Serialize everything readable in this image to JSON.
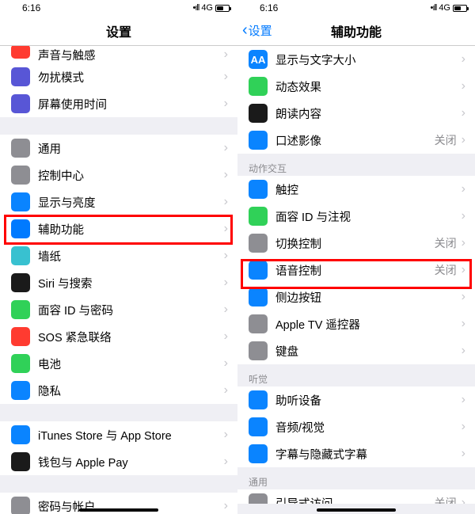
{
  "status": {
    "time": "6:16",
    "net": "4G",
    "signal": "•ıll"
  },
  "left": {
    "title": "设置",
    "rows": [
      {
        "id": "sound-haptics",
        "label": "声音与触感",
        "color": "#ff3b30"
      },
      {
        "id": "dnd",
        "label": "勿扰模式",
        "color": "#5856d6"
      },
      {
        "id": "screen-time",
        "label": "屏幕使用时间",
        "color": "#5856d6"
      },
      {
        "id": "general",
        "label": "通用",
        "color": "#8e8e93"
      },
      {
        "id": "control-center",
        "label": "控制中心",
        "color": "#8e8e93"
      },
      {
        "id": "display",
        "label": "显示与亮度",
        "color": "#0a84ff"
      },
      {
        "id": "accessibility",
        "label": "辅助功能",
        "color": "#007aff"
      },
      {
        "id": "wallpaper",
        "label": "墙纸",
        "color": "#38c1d0"
      },
      {
        "id": "siri",
        "label": "Siri 与搜索",
        "color": "#1a1a1a"
      },
      {
        "id": "faceid",
        "label": "面容 ID 与密码",
        "color": "#30d158"
      },
      {
        "id": "sos",
        "label": "SOS 紧急联络",
        "color": "#ff3b30"
      },
      {
        "id": "battery",
        "label": "电池",
        "color": "#30d158"
      },
      {
        "id": "privacy",
        "label": "隐私",
        "color": "#0a84ff"
      },
      {
        "id": "itunes",
        "label": "iTunes Store 与 App Store",
        "color": "#0a84ff"
      },
      {
        "id": "wallet",
        "label": "钱包与 Apple Pay",
        "color": "#1a1a1a"
      },
      {
        "id": "accounts",
        "label": "密码与帐户",
        "color": "#8e8e93"
      }
    ]
  },
  "right": {
    "back": "设置",
    "title": "辅助功能",
    "sections": {
      "vision": [
        {
          "id": "text-size",
          "label": "显示与文字大小",
          "color": "#0a84ff",
          "glyph": "AA"
        },
        {
          "id": "motion",
          "label": "动态效果",
          "color": "#30d158"
        },
        {
          "id": "spoken",
          "label": "朗读内容",
          "color": "#1a1a1a"
        },
        {
          "id": "audio-desc",
          "label": "口述影像",
          "color": "#0a84ff",
          "value": "关闭"
        }
      ],
      "motor_header": "动作交互",
      "motor": [
        {
          "id": "touch",
          "label": "触控",
          "color": "#0a84ff"
        },
        {
          "id": "face-attention",
          "label": "面容 ID 与注视",
          "color": "#30d158"
        },
        {
          "id": "switch-control",
          "label": "切换控制",
          "color": "#8e8e93",
          "value": "关闭"
        },
        {
          "id": "voice-control",
          "label": "语音控制",
          "color": "#0a84ff",
          "value": "关闭"
        },
        {
          "id": "side-button",
          "label": "侧边按钮",
          "color": "#0a84ff"
        },
        {
          "id": "apple-tv",
          "label": "Apple TV 遥控器",
          "color": "#8e8e93"
        },
        {
          "id": "keyboards",
          "label": "键盘",
          "color": "#8e8e93"
        }
      ],
      "hearing_header": "听觉",
      "hearing": [
        {
          "id": "hearing-devices",
          "label": "助听设备",
          "color": "#0a84ff"
        },
        {
          "id": "audio-visual",
          "label": "音频/视觉",
          "color": "#0a84ff"
        },
        {
          "id": "subtitles",
          "label": "字幕与隐藏式字幕",
          "color": "#0a84ff"
        }
      ],
      "general_header": "通用",
      "general": [
        {
          "id": "guided-access",
          "label": "引导式访问",
          "color": "#8e8e93",
          "value": "关闭"
        }
      ]
    }
  }
}
